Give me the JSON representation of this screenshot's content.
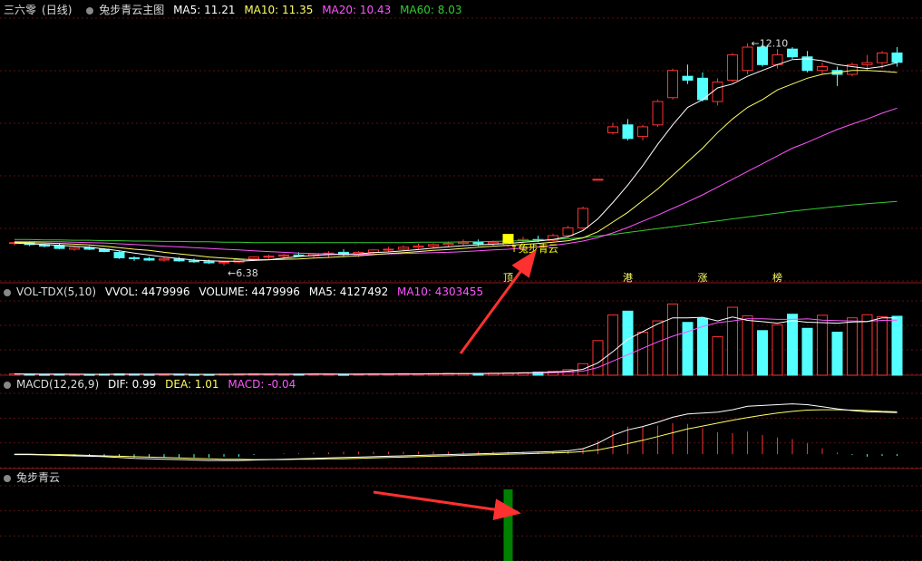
{
  "colors": {
    "bg": "#000000",
    "up": "#ff3232",
    "down": "#54ffff",
    "ma5": "#ffffff",
    "ma10": "#ffff66",
    "ma20": "#ff55ff",
    "ma60": "#33cc33",
    "grid": "#5a1010",
    "text": "#cccccc",
    "signal_bar": "#008000",
    "arrow": "#ff3030",
    "marker": "#ffff00"
  },
  "main": {
    "stock_name": "三六零",
    "period": "(日线)",
    "indicator_name": "兔步青云主图",
    "ma5": {
      "label": "MA5: 11.21",
      "color": "#ffffff"
    },
    "ma10": {
      "label": "MA10: 11.35",
      "color": "#ffff66"
    },
    "ma20": {
      "label": "MA20: 10.43",
      "color": "#ff55ff"
    },
    "ma60": {
      "label": "MA60: 8.03",
      "color": "#33cc33"
    },
    "high_label": "12.10",
    "low_label": "6.38",
    "signal_text": "兔步青云",
    "markers": [
      {
        "i": 33,
        "text": "顶"
      },
      {
        "i": 41,
        "text": "港"
      },
      {
        "i": 46,
        "text": "涨"
      },
      {
        "i": 51,
        "text": "榜"
      }
    ]
  },
  "volume": {
    "name": "VOL-TDX(5,10)",
    "vvol": "VVOL: 4479996",
    "volume": "VOLUME: 4479996",
    "ma5": "MA5: 4127492",
    "ma10": "MA10: 4303455"
  },
  "macd": {
    "name": "MACD(12,26,9)",
    "dif": "DIF: 0.99",
    "dea": "DEA: 1.01",
    "macd": "MACD: -0.04"
  },
  "signal": {
    "name": "兔步青云",
    "bar_index": 33
  },
  "chart_data": {
    "type": "candlestick",
    "ohlc": [
      [
        6.95,
        6.99,
        6.9,
        6.97
      ],
      [
        6.97,
        7.0,
        6.88,
        6.92
      ],
      [
        6.92,
        6.94,
        6.85,
        6.88
      ],
      [
        6.9,
        6.95,
        6.8,
        6.82
      ],
      [
        6.8,
        6.86,
        6.76,
        6.84
      ],
      [
        6.84,
        6.88,
        6.78,
        6.8
      ],
      [
        6.8,
        6.83,
        6.72,
        6.74
      ],
      [
        6.72,
        6.75,
        6.55,
        6.58
      ],
      [
        6.58,
        6.62,
        6.5,
        6.56
      ],
      [
        6.56,
        6.6,
        6.5,
        6.52
      ],
      [
        6.52,
        6.58,
        6.48,
        6.55
      ],
      [
        6.55,
        6.6,
        6.48,
        6.5
      ],
      [
        6.5,
        6.56,
        6.45,
        6.48
      ],
      [
        6.48,
        6.53,
        6.42,
        6.45
      ],
      [
        6.45,
        6.5,
        6.38,
        6.47
      ],
      [
        6.47,
        6.55,
        6.44,
        6.53
      ],
      [
        6.55,
        6.62,
        6.5,
        6.6
      ],
      [
        6.6,
        6.66,
        6.55,
        6.62
      ],
      [
        6.62,
        6.68,
        6.56,
        6.65
      ],
      [
        6.65,
        6.72,
        6.6,
        6.63
      ],
      [
        6.63,
        6.7,
        6.58,
        6.68
      ],
      [
        6.68,
        6.75,
        6.6,
        6.7
      ],
      [
        6.72,
        6.8,
        6.62,
        6.66
      ],
      [
        6.66,
        6.75,
        6.6,
        6.72
      ],
      [
        6.72,
        6.8,
        6.66,
        6.78
      ],
      [
        6.78,
        6.86,
        6.72,
        6.8
      ],
      [
        6.8,
        6.9,
        6.75,
        6.85
      ],
      [
        6.85,
        6.95,
        6.8,
        6.88
      ],
      [
        6.88,
        6.96,
        6.82,
        6.92
      ],
      [
        6.92,
        7.0,
        6.86,
        6.95
      ],
      [
        6.95,
        7.05,
        6.9,
        6.98
      ],
      [
        6.98,
        7.05,
        6.88,
        6.94
      ],
      [
        6.94,
        7.02,
        6.88,
        6.98
      ],
      [
        6.9,
        7.1,
        6.86,
        7.02
      ],
      [
        7.02,
        7.12,
        6.95,
        7.05
      ],
      [
        7.05,
        7.15,
        6.98,
        7.03
      ],
      [
        7.03,
        7.2,
        7.0,
        7.15
      ],
      [
        7.15,
        7.4,
        7.1,
        7.35
      ],
      [
        7.35,
        7.9,
        7.3,
        7.85
      ],
      [
        8.6,
        8.6,
        8.6,
        8.6
      ],
      [
        9.8,
        10.05,
        9.75,
        9.95
      ],
      [
        10.0,
        10.15,
        9.6,
        9.65
      ],
      [
        9.7,
        10.0,
        9.6,
        9.95
      ],
      [
        10.0,
        10.65,
        9.95,
        10.6
      ],
      [
        10.7,
        11.45,
        10.65,
        11.4
      ],
      [
        11.25,
        11.55,
        11.05,
        11.15
      ],
      [
        11.2,
        11.35,
        10.6,
        10.65
      ],
      [
        10.6,
        11.2,
        10.5,
        11.1
      ],
      [
        11.15,
        11.85,
        11.1,
        11.8
      ],
      [
        11.4,
        12.1,
        11.3,
        12.0
      ],
      [
        12.0,
        12.08,
        11.5,
        11.55
      ],
      [
        11.55,
        11.95,
        11.45,
        11.8
      ],
      [
        11.95,
        12.0,
        11.7,
        11.75
      ],
      [
        11.75,
        11.9,
        11.35,
        11.4
      ],
      [
        11.4,
        11.6,
        11.3,
        11.5
      ],
      [
        11.4,
        11.5,
        11.0,
        11.3
      ],
      [
        11.3,
        11.6,
        11.25,
        11.55
      ],
      [
        11.55,
        11.8,
        11.4,
        11.6
      ],
      [
        11.6,
        11.9,
        11.45,
        11.85
      ],
      [
        11.85,
        12.0,
        11.5,
        11.61
      ]
    ],
    "ma5": [
      6.96,
      6.94,
      6.92,
      6.9,
      6.88,
      6.85,
      6.81,
      6.76,
      6.7,
      6.65,
      6.6,
      6.56,
      6.52,
      6.5,
      6.49,
      6.49,
      6.51,
      6.53,
      6.57,
      6.61,
      6.64,
      6.66,
      6.67,
      6.68,
      6.71,
      6.73,
      6.76,
      6.79,
      6.83,
      6.86,
      6.89,
      6.91,
      6.93,
      6.95,
      6.98,
      7.01,
      7.05,
      7.12,
      7.28,
      7.58,
      8.0,
      8.45,
      8.95,
      9.5,
      10.0,
      10.45,
      10.65,
      10.95,
      11.05,
      11.25,
      11.4,
      11.55,
      11.68,
      11.7,
      11.65,
      11.55,
      11.5,
      11.45,
      11.5,
      11.6
    ],
    "ma10": [
      6.98,
      6.97,
      6.96,
      6.95,
      6.93,
      6.91,
      6.88,
      6.84,
      6.8,
      6.77,
      6.72,
      6.68,
      6.64,
      6.6,
      6.57,
      6.55,
      6.53,
      6.53,
      6.54,
      6.55,
      6.57,
      6.59,
      6.61,
      6.63,
      6.66,
      6.69,
      6.71,
      6.74,
      6.77,
      6.79,
      6.82,
      6.85,
      6.88,
      6.9,
      6.92,
      6.95,
      6.98,
      7.02,
      7.09,
      7.25,
      7.5,
      7.75,
      8.05,
      8.35,
      8.7,
      9.05,
      9.4,
      9.8,
      10.15,
      10.45,
      10.65,
      10.9,
      11.05,
      11.2,
      11.3,
      11.35,
      11.4,
      11.4,
      11.38,
      11.35
    ],
    "ma20": [
      7.0,
      7.0,
      6.99,
      6.99,
      6.98,
      6.97,
      6.96,
      6.94,
      6.92,
      6.9,
      6.88,
      6.86,
      6.84,
      6.82,
      6.8,
      6.78,
      6.76,
      6.74,
      6.72,
      6.7,
      6.69,
      6.68,
      6.67,
      6.67,
      6.67,
      6.68,
      6.69,
      6.7,
      6.71,
      6.72,
      6.74,
      6.76,
      6.78,
      6.8,
      6.83,
      6.86,
      6.9,
      6.95,
      7.01,
      7.1,
      7.22,
      7.36,
      7.52,
      7.68,
      7.85,
      8.02,
      8.2,
      8.4,
      8.6,
      8.8,
      9.0,
      9.2,
      9.4,
      9.55,
      9.72,
      9.88,
      10.02,
      10.15,
      10.3,
      10.43
    ],
    "ma60": [
      7.05,
      7.05,
      7.04,
      7.04,
      7.03,
      7.03,
      7.02,
      7.02,
      7.01,
      7.01,
      7.0,
      7.0,
      6.99,
      6.99,
      6.98,
      6.98,
      6.97,
      6.97,
      6.97,
      6.97,
      6.97,
      6.97,
      6.97,
      6.97,
      6.97,
      6.97,
      6.97,
      6.98,
      6.98,
      6.98,
      6.99,
      6.99,
      7.0,
      7.01,
      7.02,
      7.03,
      7.05,
      7.07,
      7.1,
      7.14,
      7.18,
      7.23,
      7.28,
      7.33,
      7.38,
      7.43,
      7.48,
      7.53,
      7.58,
      7.63,
      7.68,
      7.73,
      7.78,
      7.82,
      7.86,
      7.9,
      7.94,
      7.97,
      8.0,
      8.03
    ],
    "volume": [
      5,
      4,
      3,
      4,
      3,
      3,
      4,
      5,
      4,
      3,
      3,
      4,
      3,
      3,
      4,
      4,
      5,
      4,
      3,
      4,
      5,
      4,
      3,
      4,
      5,
      5,
      6,
      5,
      6,
      7,
      6,
      7,
      8,
      9,
      10,
      12,
      15,
      22,
      45,
      135,
      235,
      250,
      168,
      212,
      278,
      206,
      222,
      150,
      265,
      232,
      174,
      196,
      238,
      183,
      234,
      168,
      224,
      236,
      228,
      230
    ],
    "vol_ma5": [
      5,
      4.5,
      4,
      4,
      4,
      3.5,
      3.5,
      4,
      4,
      4,
      4,
      3.8,
      3.6,
      3.5,
      3.6,
      3.8,
      4,
      4,
      4,
      4,
      4.2,
      4.2,
      4,
      4,
      4.3,
      4.5,
      4.8,
      5,
      5.5,
      6,
      6.5,
      6.8,
      7,
      8,
      9,
      10.5,
      12.5,
      16,
      23,
      48,
      92,
      140,
      170,
      200,
      224,
      224,
      226,
      212,
      227,
      214,
      209,
      203,
      213,
      207,
      205,
      203,
      208,
      209,
      224,
      224
    ],
    "vol_ma10": [
      5,
      4.6,
      4.2,
      4.1,
      4,
      3.8,
      3.7,
      3.8,
      3.9,
      3.9,
      3.9,
      3.8,
      3.7,
      3.6,
      3.6,
      3.7,
      3.8,
      3.9,
      3.9,
      4,
      4.1,
      4.1,
      4.1,
      4.1,
      4.2,
      4.4,
      4.6,
      4.8,
      5.1,
      5.4,
      5.8,
      6.2,
      6.6,
      7.2,
      7.8,
      8.8,
      10,
      12,
      16,
      30,
      55,
      80,
      105,
      130,
      152,
      170,
      190,
      205,
      212,
      220,
      220,
      218,
      218,
      220,
      215,
      213,
      212,
      210,
      214,
      215
    ],
    "dif": [
      -0.01,
      -0.01,
      -0.02,
      -0.03,
      -0.04,
      -0.05,
      -0.06,
      -0.08,
      -0.1,
      -0.11,
      -0.12,
      -0.13,
      -0.14,
      -0.15,
      -0.15,
      -0.15,
      -0.14,
      -0.13,
      -0.12,
      -0.11,
      -0.1,
      -0.09,
      -0.08,
      -0.07,
      -0.06,
      -0.05,
      -0.04,
      -0.03,
      -0.02,
      -0.01,
      0.0,
      0.01,
      0.02,
      0.03,
      0.04,
      0.05,
      0.06,
      0.08,
      0.13,
      0.26,
      0.45,
      0.58,
      0.66,
      0.76,
      0.88,
      0.96,
      0.98,
      1.0,
      1.06,
      1.14,
      1.16,
      1.18,
      1.2,
      1.18,
      1.13,
      1.08,
      1.04,
      1.01,
      1.0,
      0.99
    ],
    "dea": [
      0.0,
      0.0,
      -0.01,
      -0.01,
      -0.02,
      -0.03,
      -0.04,
      -0.05,
      -0.06,
      -0.07,
      -0.08,
      -0.09,
      -0.1,
      -0.11,
      -0.12,
      -0.12,
      -0.13,
      -0.13,
      -0.13,
      -0.12,
      -0.12,
      -0.11,
      -0.11,
      -0.1,
      -0.09,
      -0.08,
      -0.07,
      -0.06,
      -0.05,
      -0.04,
      -0.03,
      -0.02,
      -0.01,
      0.0,
      0.01,
      0.02,
      0.03,
      0.04,
      0.06,
      0.1,
      0.17,
      0.25,
      0.33,
      0.42,
      0.51,
      0.6,
      0.67,
      0.74,
      0.81,
      0.87,
      0.93,
      0.98,
      1.02,
      1.05,
      1.06,
      1.06,
      1.05,
      1.04,
      1.02,
      1.01
    ],
    "xlabel": "",
    "ylabel": ""
  }
}
